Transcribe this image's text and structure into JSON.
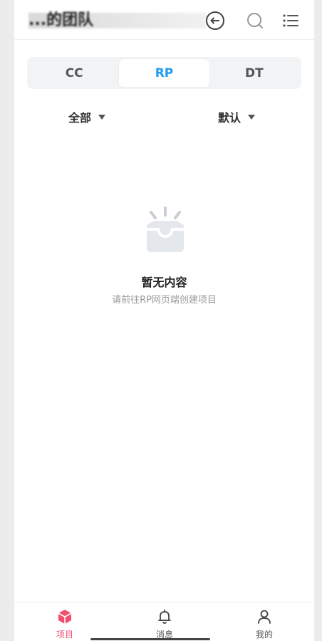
{
  "header": {
    "title": "...的团队",
    "icons": [
      "back-arrow-icon",
      "switch-team-icon",
      "search-icon",
      "menu-list-icon"
    ]
  },
  "tabs": [
    {
      "label": "CC",
      "active": false
    },
    {
      "label": "RP",
      "active": true
    },
    {
      "label": "DT",
      "active": false
    }
  ],
  "filters": {
    "scope": "全部",
    "sort": "默认"
  },
  "empty_state": {
    "title": "暂无内容",
    "subtitle": "请前往RP网页端创建项目",
    "icon": "empty-tray-icon"
  },
  "bottom_nav": [
    {
      "label": "项目",
      "icon": "cube-icon",
      "active": true
    },
    {
      "label": "消息",
      "icon": "bell-icon",
      "active": false
    },
    {
      "label": "我的",
      "icon": "user-icon",
      "active": false
    }
  ],
  "colors": {
    "accent": "#1e9bf0",
    "nav_active": "#f0506e",
    "background": "#ffffff",
    "gutter": "#ececec"
  }
}
